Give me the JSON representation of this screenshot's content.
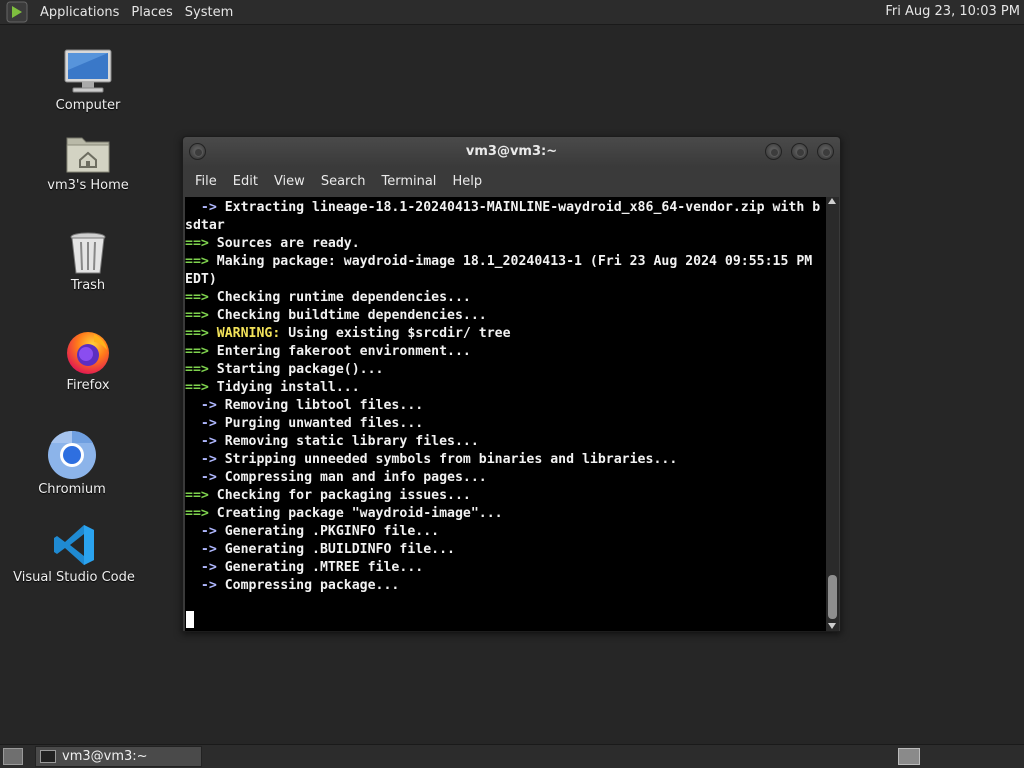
{
  "top_panel": {
    "menus": [
      "Applications",
      "Places",
      "System"
    ],
    "clock": "Fri Aug 23, 10:03 PM"
  },
  "desktop": {
    "icons": [
      {
        "label": "Computer",
        "icon": "monitor-icon"
      },
      {
        "label": "vm3's Home",
        "icon": "home-folder-icon"
      },
      {
        "label": "Trash",
        "icon": "trash-icon"
      },
      {
        "label": "Firefox",
        "icon": "firefox-icon"
      },
      {
        "label": "Chromium",
        "icon": "chromium-icon"
      },
      {
        "label": "Visual Studio Code",
        "icon": "vscode-icon"
      }
    ]
  },
  "terminal": {
    "title": "vm3@vm3:~",
    "menu": [
      "File",
      "Edit",
      "View",
      "Search",
      "Terminal",
      "Help"
    ],
    "lines": [
      {
        "prefix": "  ->",
        "kind": "sub",
        "text": " Extracting lineage-18.1-20240413-MAINLINE-waydroid_x86_64-vendor.zip with b"
      },
      {
        "prefix": "",
        "kind": "plain",
        "text": "sdtar"
      },
      {
        "prefix": "==>",
        "kind": "main",
        "text": " Sources are ready."
      },
      {
        "prefix": "==>",
        "kind": "main",
        "text": " Making package: waydroid-image 18.1_20240413-1 (Fri 23 Aug 2024 09:55:15 PM"
      },
      {
        "prefix": "",
        "kind": "plain",
        "text": "EDT)"
      },
      {
        "prefix": "==>",
        "kind": "main",
        "text": " Checking runtime dependencies..."
      },
      {
        "prefix": "==>",
        "kind": "main",
        "text": " Checking buildtime dependencies..."
      },
      {
        "prefix": "==>",
        "kind": "warn",
        "text": " Using existing $srcdir/ tree",
        "label": " WARNING:"
      },
      {
        "prefix": "==>",
        "kind": "main",
        "text": " Entering fakeroot environment..."
      },
      {
        "prefix": "==>",
        "kind": "main",
        "text": " Starting package()..."
      },
      {
        "prefix": "==>",
        "kind": "main",
        "text": " Tidying install..."
      },
      {
        "prefix": "  ->",
        "kind": "sub",
        "text": " Removing libtool files..."
      },
      {
        "prefix": "  ->",
        "kind": "sub",
        "text": " Purging unwanted files..."
      },
      {
        "prefix": "  ->",
        "kind": "sub",
        "text": " Removing static library files..."
      },
      {
        "prefix": "  ->",
        "kind": "sub",
        "text": " Stripping unneeded symbols from binaries and libraries..."
      },
      {
        "prefix": "  ->",
        "kind": "sub",
        "text": " Compressing man and info pages..."
      },
      {
        "prefix": "==>",
        "kind": "main",
        "text": " Checking for packaging issues..."
      },
      {
        "prefix": "==>",
        "kind": "main",
        "text": " Creating package \"waydroid-image\"..."
      },
      {
        "prefix": "  ->",
        "kind": "sub",
        "text": " Generating .PKGINFO file..."
      },
      {
        "prefix": "  ->",
        "kind": "sub",
        "text": " Generating .BUILDINFO file..."
      },
      {
        "prefix": "  ->",
        "kind": "sub",
        "text": " Generating .MTREE file..."
      },
      {
        "prefix": "  ->",
        "kind": "sub",
        "text": " Compressing package..."
      }
    ]
  },
  "taskbar": {
    "task_label": "vm3@vm3:~"
  },
  "colors": {
    "main_arrow": "#7fd34e",
    "sub_arrow": "#b0b8ff",
    "warning": "#f3e35a",
    "terminal_bg": "#000000"
  }
}
